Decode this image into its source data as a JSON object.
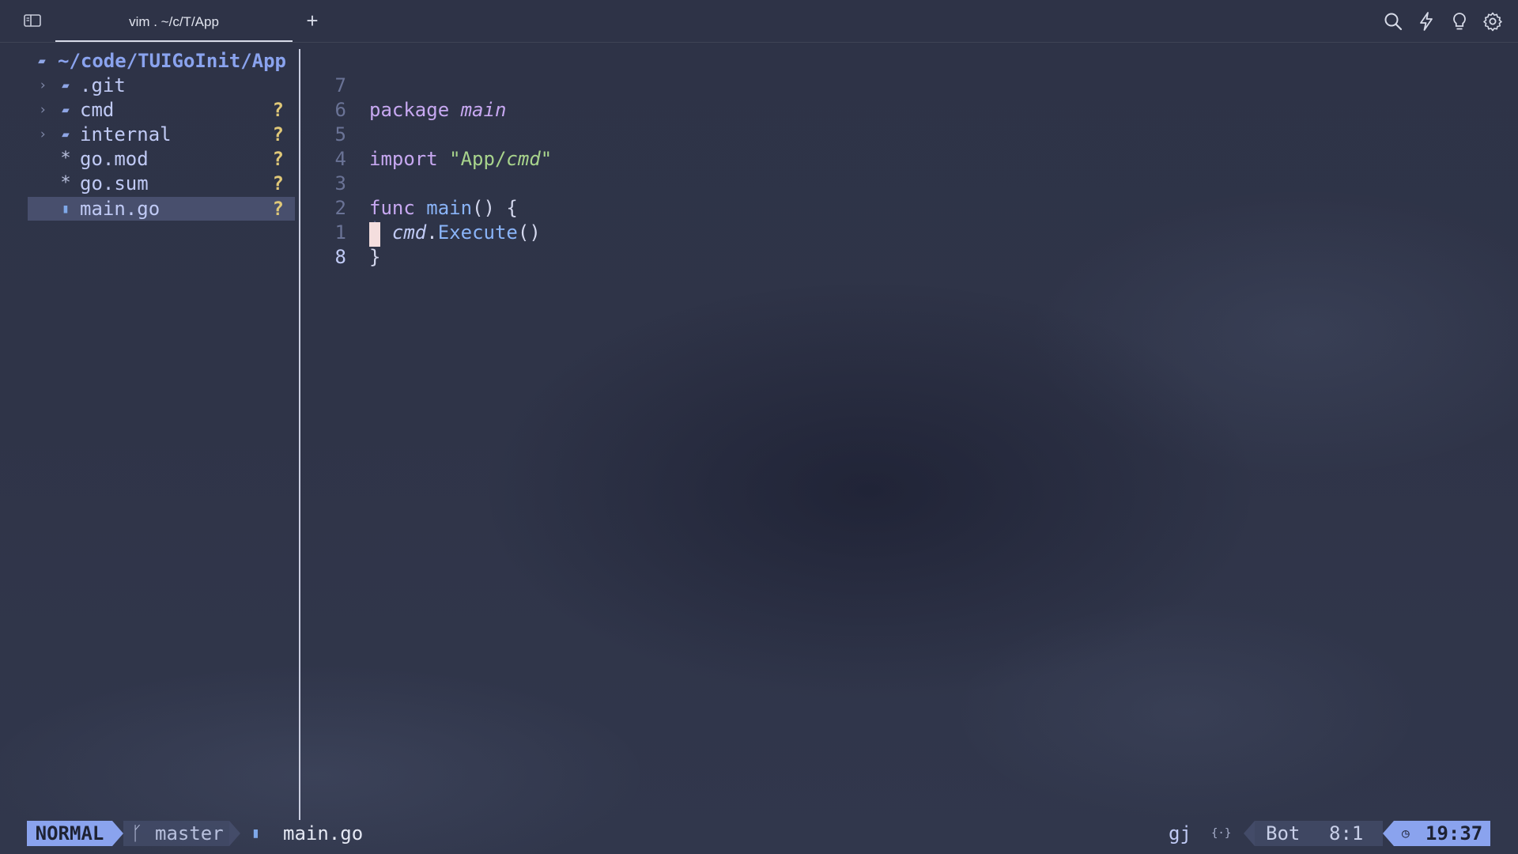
{
  "window": {
    "tab_title": "vim . ~/c/T/App",
    "new_tab_label": "+"
  },
  "toolbar": {
    "icons": [
      "sidebar-toggle-icon",
      "search-icon",
      "lightning-icon",
      "lightbulb-icon",
      "gear-icon"
    ]
  },
  "tree": {
    "root": "~/code/TUIGoInit/App",
    "items": [
      {
        "chevron": "›",
        "icon": "folder",
        "name": ".git",
        "status": ""
      },
      {
        "chevron": "›",
        "icon": "folder",
        "name": "cmd",
        "status": "?"
      },
      {
        "chevron": "›",
        "icon": "folder",
        "name": "internal",
        "status": "?"
      },
      {
        "chevron": "",
        "icon": "*",
        "name": "go.mod",
        "status": "?"
      },
      {
        "chevron": "",
        "icon": "*",
        "name": "go.sum",
        "status": "?"
      },
      {
        "chevron": "",
        "icon": "gopher",
        "name": "main.go",
        "status": "?",
        "selected": true
      }
    ]
  },
  "editor": {
    "line_numbers": [
      "7",
      "6",
      "5",
      "4",
      "3",
      "2",
      "1",
      "8"
    ],
    "code": {
      "l1_kw": "package",
      "l1_name": "main",
      "l3_kw": "import",
      "l3_q1": "\"App/",
      "l3_ital": "cmd",
      "l3_q2": "\"",
      "l5_kw": "func",
      "l5_fn": "main",
      "l5_rest": "() {",
      "l6_guide": "│",
      "l6_obj": "cmd",
      "l6_dot": ".",
      "l6_fn": "Execute",
      "l6_rest": "()",
      "l7": "}"
    }
  },
  "statusline": {
    "mode": "NORMAL",
    "branch_icon": "ᚴ",
    "branch": "master",
    "file": "main.go",
    "keys": "gj",
    "braces_icon": "{·}",
    "position_pct": "Bot",
    "line_col": "8:1",
    "clock_icon": "◷",
    "time": "19:37"
  }
}
